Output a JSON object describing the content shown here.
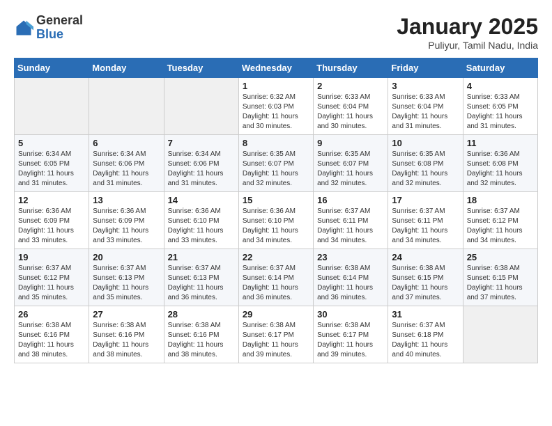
{
  "header": {
    "logo_general": "General",
    "logo_blue": "Blue",
    "title": "January 2025",
    "subtitle": "Puliyur, Tamil Nadu, India"
  },
  "weekdays": [
    "Sunday",
    "Monday",
    "Tuesday",
    "Wednesday",
    "Thursday",
    "Friday",
    "Saturday"
  ],
  "weeks": [
    [
      {
        "day": "",
        "info": ""
      },
      {
        "day": "",
        "info": ""
      },
      {
        "day": "",
        "info": ""
      },
      {
        "day": "1",
        "info": "Sunrise: 6:32 AM\nSunset: 6:03 PM\nDaylight: 11 hours\nand 30 minutes."
      },
      {
        "day": "2",
        "info": "Sunrise: 6:33 AM\nSunset: 6:04 PM\nDaylight: 11 hours\nand 30 minutes."
      },
      {
        "day": "3",
        "info": "Sunrise: 6:33 AM\nSunset: 6:04 PM\nDaylight: 11 hours\nand 31 minutes."
      },
      {
        "day": "4",
        "info": "Sunrise: 6:33 AM\nSunset: 6:05 PM\nDaylight: 11 hours\nand 31 minutes."
      }
    ],
    [
      {
        "day": "5",
        "info": "Sunrise: 6:34 AM\nSunset: 6:05 PM\nDaylight: 11 hours\nand 31 minutes."
      },
      {
        "day": "6",
        "info": "Sunrise: 6:34 AM\nSunset: 6:06 PM\nDaylight: 11 hours\nand 31 minutes."
      },
      {
        "day": "7",
        "info": "Sunrise: 6:34 AM\nSunset: 6:06 PM\nDaylight: 11 hours\nand 31 minutes."
      },
      {
        "day": "8",
        "info": "Sunrise: 6:35 AM\nSunset: 6:07 PM\nDaylight: 11 hours\nand 32 minutes."
      },
      {
        "day": "9",
        "info": "Sunrise: 6:35 AM\nSunset: 6:07 PM\nDaylight: 11 hours\nand 32 minutes."
      },
      {
        "day": "10",
        "info": "Sunrise: 6:35 AM\nSunset: 6:08 PM\nDaylight: 11 hours\nand 32 minutes."
      },
      {
        "day": "11",
        "info": "Sunrise: 6:36 AM\nSunset: 6:08 PM\nDaylight: 11 hours\nand 32 minutes."
      }
    ],
    [
      {
        "day": "12",
        "info": "Sunrise: 6:36 AM\nSunset: 6:09 PM\nDaylight: 11 hours\nand 33 minutes."
      },
      {
        "day": "13",
        "info": "Sunrise: 6:36 AM\nSunset: 6:09 PM\nDaylight: 11 hours\nand 33 minutes."
      },
      {
        "day": "14",
        "info": "Sunrise: 6:36 AM\nSunset: 6:10 PM\nDaylight: 11 hours\nand 33 minutes."
      },
      {
        "day": "15",
        "info": "Sunrise: 6:36 AM\nSunset: 6:10 PM\nDaylight: 11 hours\nand 34 minutes."
      },
      {
        "day": "16",
        "info": "Sunrise: 6:37 AM\nSunset: 6:11 PM\nDaylight: 11 hours\nand 34 minutes."
      },
      {
        "day": "17",
        "info": "Sunrise: 6:37 AM\nSunset: 6:11 PM\nDaylight: 11 hours\nand 34 minutes."
      },
      {
        "day": "18",
        "info": "Sunrise: 6:37 AM\nSunset: 6:12 PM\nDaylight: 11 hours\nand 34 minutes."
      }
    ],
    [
      {
        "day": "19",
        "info": "Sunrise: 6:37 AM\nSunset: 6:12 PM\nDaylight: 11 hours\nand 35 minutes."
      },
      {
        "day": "20",
        "info": "Sunrise: 6:37 AM\nSunset: 6:13 PM\nDaylight: 11 hours\nand 35 minutes."
      },
      {
        "day": "21",
        "info": "Sunrise: 6:37 AM\nSunset: 6:13 PM\nDaylight: 11 hours\nand 36 minutes."
      },
      {
        "day": "22",
        "info": "Sunrise: 6:37 AM\nSunset: 6:14 PM\nDaylight: 11 hours\nand 36 minutes."
      },
      {
        "day": "23",
        "info": "Sunrise: 6:38 AM\nSunset: 6:14 PM\nDaylight: 11 hours\nand 36 minutes."
      },
      {
        "day": "24",
        "info": "Sunrise: 6:38 AM\nSunset: 6:15 PM\nDaylight: 11 hours\nand 37 minutes."
      },
      {
        "day": "25",
        "info": "Sunrise: 6:38 AM\nSunset: 6:15 PM\nDaylight: 11 hours\nand 37 minutes."
      }
    ],
    [
      {
        "day": "26",
        "info": "Sunrise: 6:38 AM\nSunset: 6:16 PM\nDaylight: 11 hours\nand 38 minutes."
      },
      {
        "day": "27",
        "info": "Sunrise: 6:38 AM\nSunset: 6:16 PM\nDaylight: 11 hours\nand 38 minutes."
      },
      {
        "day": "28",
        "info": "Sunrise: 6:38 AM\nSunset: 6:16 PM\nDaylight: 11 hours\nand 38 minutes."
      },
      {
        "day": "29",
        "info": "Sunrise: 6:38 AM\nSunset: 6:17 PM\nDaylight: 11 hours\nand 39 minutes."
      },
      {
        "day": "30",
        "info": "Sunrise: 6:38 AM\nSunset: 6:17 PM\nDaylight: 11 hours\nand 39 minutes."
      },
      {
        "day": "31",
        "info": "Sunrise: 6:37 AM\nSunset: 6:18 PM\nDaylight: 11 hours\nand 40 minutes."
      },
      {
        "day": "",
        "info": ""
      }
    ]
  ]
}
